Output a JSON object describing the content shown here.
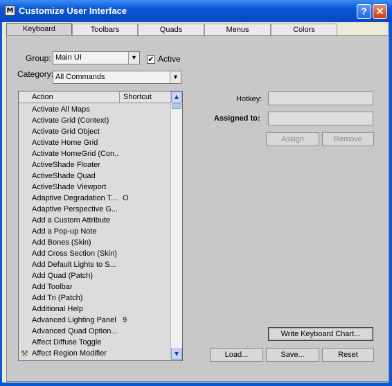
{
  "window": {
    "title": "Customize User Interface",
    "help_label": "?",
    "close_label": "✕"
  },
  "tabs": [
    {
      "label": "Keyboard",
      "active": true
    },
    {
      "label": "Toolbars"
    },
    {
      "label": "Quads"
    },
    {
      "label": "Menus"
    },
    {
      "label": "Colors"
    }
  ],
  "group": {
    "label": "Group:",
    "value": "Main UI"
  },
  "active_checkbox": {
    "label": "Active",
    "checked": true,
    "mark": "✔"
  },
  "category": {
    "label": "Category:",
    "value": "All Commands"
  },
  "dropdown_arrow": "▼",
  "list": {
    "headers": {
      "action": "Action",
      "shortcut": "Shortcut"
    },
    "rows": [
      {
        "action": "Activate All Maps",
        "shortcut": ""
      },
      {
        "action": "Activate Grid (Context)",
        "shortcut": ""
      },
      {
        "action": "Activate Grid Object",
        "shortcut": ""
      },
      {
        "action": "Activate Home Grid",
        "shortcut": ""
      },
      {
        "action": "Activate HomeGrid (Con...",
        "shortcut": ""
      },
      {
        "action": "ActiveShade Floater",
        "shortcut": ""
      },
      {
        "action": "ActiveShade Quad",
        "shortcut": ""
      },
      {
        "action": "ActiveShade Viewport",
        "shortcut": ""
      },
      {
        "action": "Adaptive Degradation T...",
        "shortcut": "O"
      },
      {
        "action": "Adaptive Perspective G...",
        "shortcut": ""
      },
      {
        "action": "Add a Custom Attribute",
        "shortcut": ""
      },
      {
        "action": "Add a Pop-up Note",
        "shortcut": ""
      },
      {
        "action": "Add Bones (Skin)",
        "shortcut": ""
      },
      {
        "action": "Add Cross Section (Skin)",
        "shortcut": ""
      },
      {
        "action": "Add Default Lights to S...",
        "shortcut": ""
      },
      {
        "action": "Add Quad (Patch)",
        "shortcut": ""
      },
      {
        "action": "Add Toolbar",
        "shortcut": ""
      },
      {
        "action": "Add Tri (Patch)",
        "shortcut": ""
      },
      {
        "action": "Additional Help",
        "shortcut": ""
      },
      {
        "action": "Advanced Lighting Panel",
        "shortcut": "9"
      },
      {
        "action": "Advanced Quad Option...",
        "shortcut": ""
      },
      {
        "action": "Affect Diffuse Toggle",
        "shortcut": ""
      },
      {
        "action": "Affect Region Modifier",
        "shortcut": "",
        "icon": "modifier-icon"
      }
    ],
    "scroll_up": "▲",
    "scroll_down": "▼"
  },
  "hotkey": {
    "label": "Hotkey:",
    "value": ""
  },
  "assigned_to": {
    "label": "Assigned to:",
    "value": ""
  },
  "buttons": {
    "assign": "Assign",
    "remove": "Remove",
    "write_chart": "Write Keyboard Chart...",
    "load": "Load...",
    "save": "Save...",
    "reset": "Reset"
  },
  "colors": {
    "title_bar": "#0a58d8",
    "panel": "#c8c8c8",
    "close": "#c9401c"
  }
}
